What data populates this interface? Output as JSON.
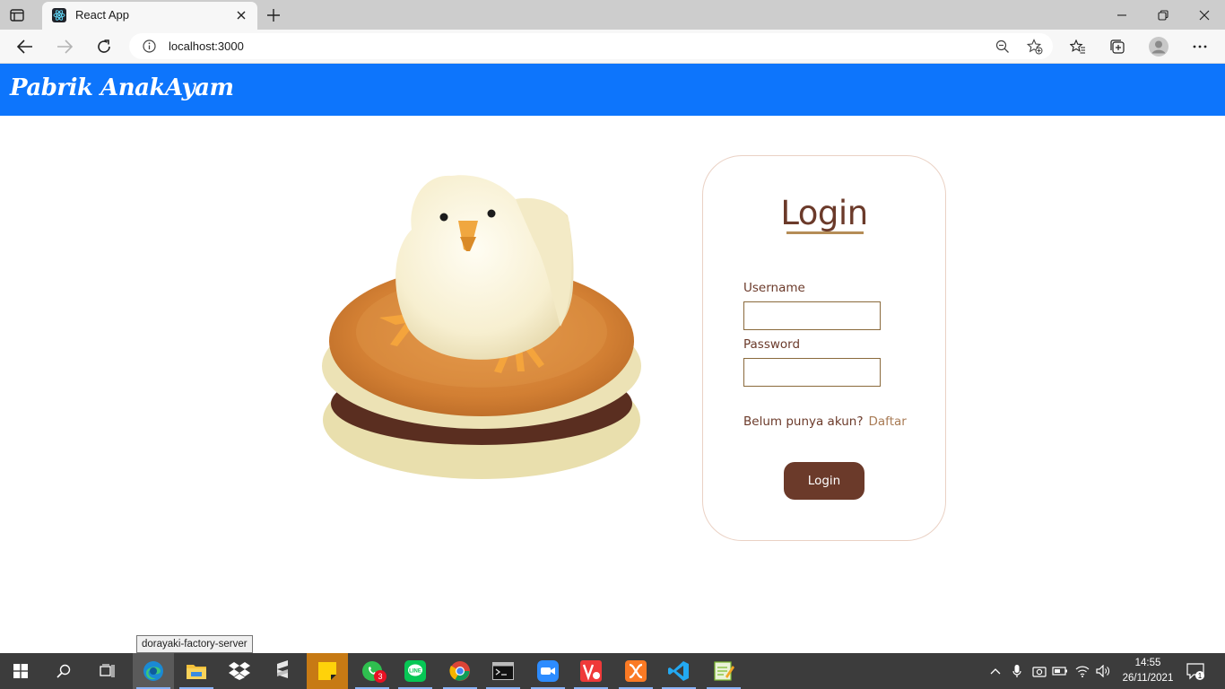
{
  "browser": {
    "tab_title": "React App",
    "url": "localhost:3000"
  },
  "app": {
    "brand": "Pabrik AnakAyam",
    "header_color": "#0d75fc"
  },
  "login": {
    "title": "Login",
    "username_label": "Username",
    "username_value": "",
    "password_label": "Password",
    "password_value": "",
    "signup_prompt": "Belum punya akun?",
    "signup_link": "Daftar",
    "submit_label": "Login",
    "accent_color": "#6b3a2a"
  },
  "tooltip": {
    "text": "dorayaki-factory-server"
  },
  "taskbar": {
    "apps": [
      {
        "name": "edge-icon",
        "active": true
      },
      {
        "name": "file-explorer-icon"
      },
      {
        "name": "dropbox-icon"
      },
      {
        "name": "sublime-icon"
      },
      {
        "name": "sticky-notes-icon"
      },
      {
        "name": "whatsapp-icon",
        "badge": "3"
      },
      {
        "name": "line-icon"
      },
      {
        "name": "chrome-icon"
      },
      {
        "name": "terminal-icon"
      },
      {
        "name": "zoom-icon"
      },
      {
        "name": "vivaldi-icon"
      },
      {
        "name": "xampp-icon"
      },
      {
        "name": "vscode-icon"
      },
      {
        "name": "notepad-plus-icon"
      }
    ],
    "whatsapp_badge": "3",
    "time": "14:55",
    "date": "26/11/2021",
    "notification_count": "1"
  }
}
